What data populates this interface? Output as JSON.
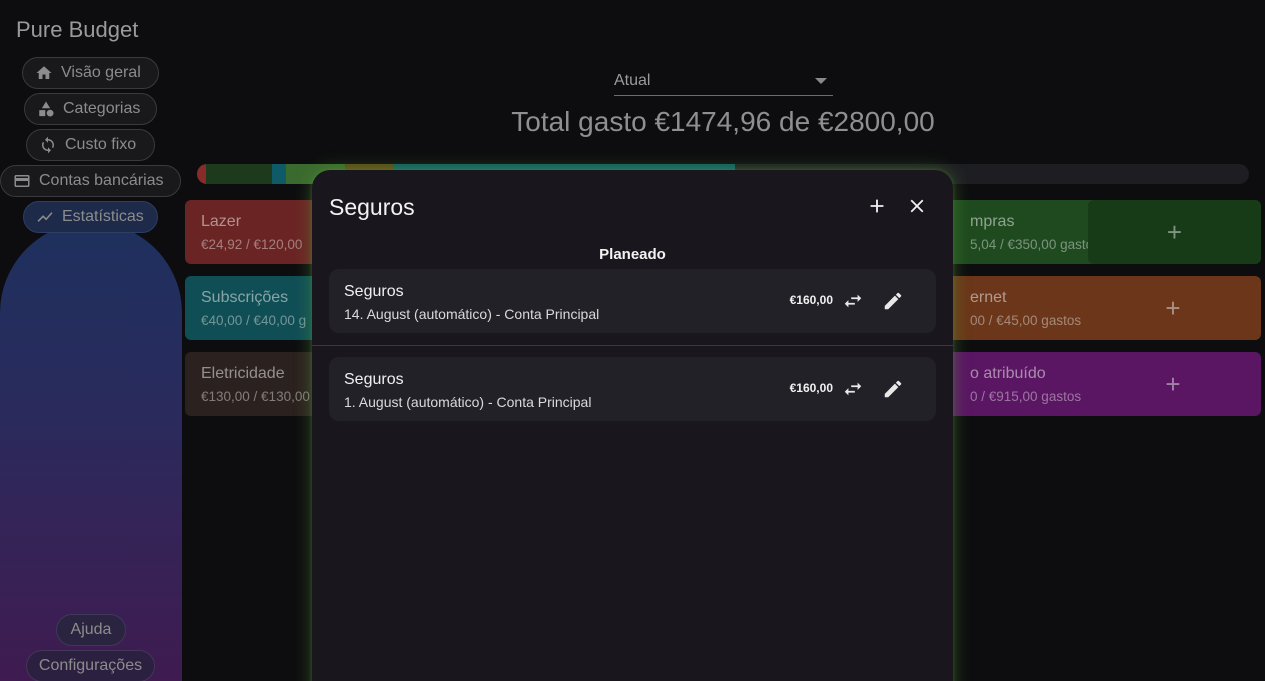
{
  "app": {
    "title": "Pure Budget"
  },
  "sidebar": {
    "items": [
      {
        "label": "Visão geral",
        "icon": "home-icon"
      },
      {
        "label": "Categorias",
        "icon": "categories-icon"
      },
      {
        "label": "Custo fixo",
        "icon": "recurring-icon"
      },
      {
        "label": "Contas bancárias",
        "icon": "bank-card-icon"
      },
      {
        "label": "Estatísticas",
        "icon": "statistics-icon"
      }
    ],
    "help_label": "Ajuda",
    "settings_label": "Configurações"
  },
  "main": {
    "period_select": {
      "selected": "Atual"
    },
    "total_title": "Total gasto €1474,96 de €2800,00",
    "progress_segments": [
      {
        "color": "#8a2b2b",
        "fraction": 0.009
      },
      {
        "color": "#1d3a1d",
        "fraction": 0.062
      },
      {
        "color": "#0e5a66",
        "fraction": 0.014
      },
      {
        "color": "#3b6a2e",
        "fraction": 0.056
      },
      {
        "color": "#5e4a18",
        "fraction": 0.045
      },
      {
        "color": "#0f5f66",
        "fraction": 0.325
      }
    ],
    "cards": [
      {
        "name": "Lazer",
        "amount": "€24,92 / €120,00",
        "color": "#6b2424"
      },
      {
        "name": "Subscrições",
        "amount": "€40,00 / €40,00 g",
        "color": "#0f4e55"
      },
      {
        "name": "Eletricidade",
        "amount": "€130,00 / €130,00",
        "color": "#2b211f"
      },
      {
        "name": "mpras",
        "amount": "5,04 / €350,00 gastos",
        "color": "#1f4a1f"
      },
      {
        "name": "ernet",
        "amount": "00 / €45,00 gastos",
        "color": "#6b3619"
      },
      {
        "name": "o atribuído",
        "amount": "0 / €915,00 gastos",
        "color": "#5a1563"
      }
    ]
  },
  "modal": {
    "title": "Seguros",
    "section_label": "Planeado",
    "entries": [
      {
        "name": "Seguros",
        "detail": "14. August (automático) - Conta Principal",
        "amount": "€160,00"
      },
      {
        "name": "Seguros",
        "detail": "1. August (automático) - Conta Principal",
        "amount": "€160,00"
      }
    ]
  }
}
